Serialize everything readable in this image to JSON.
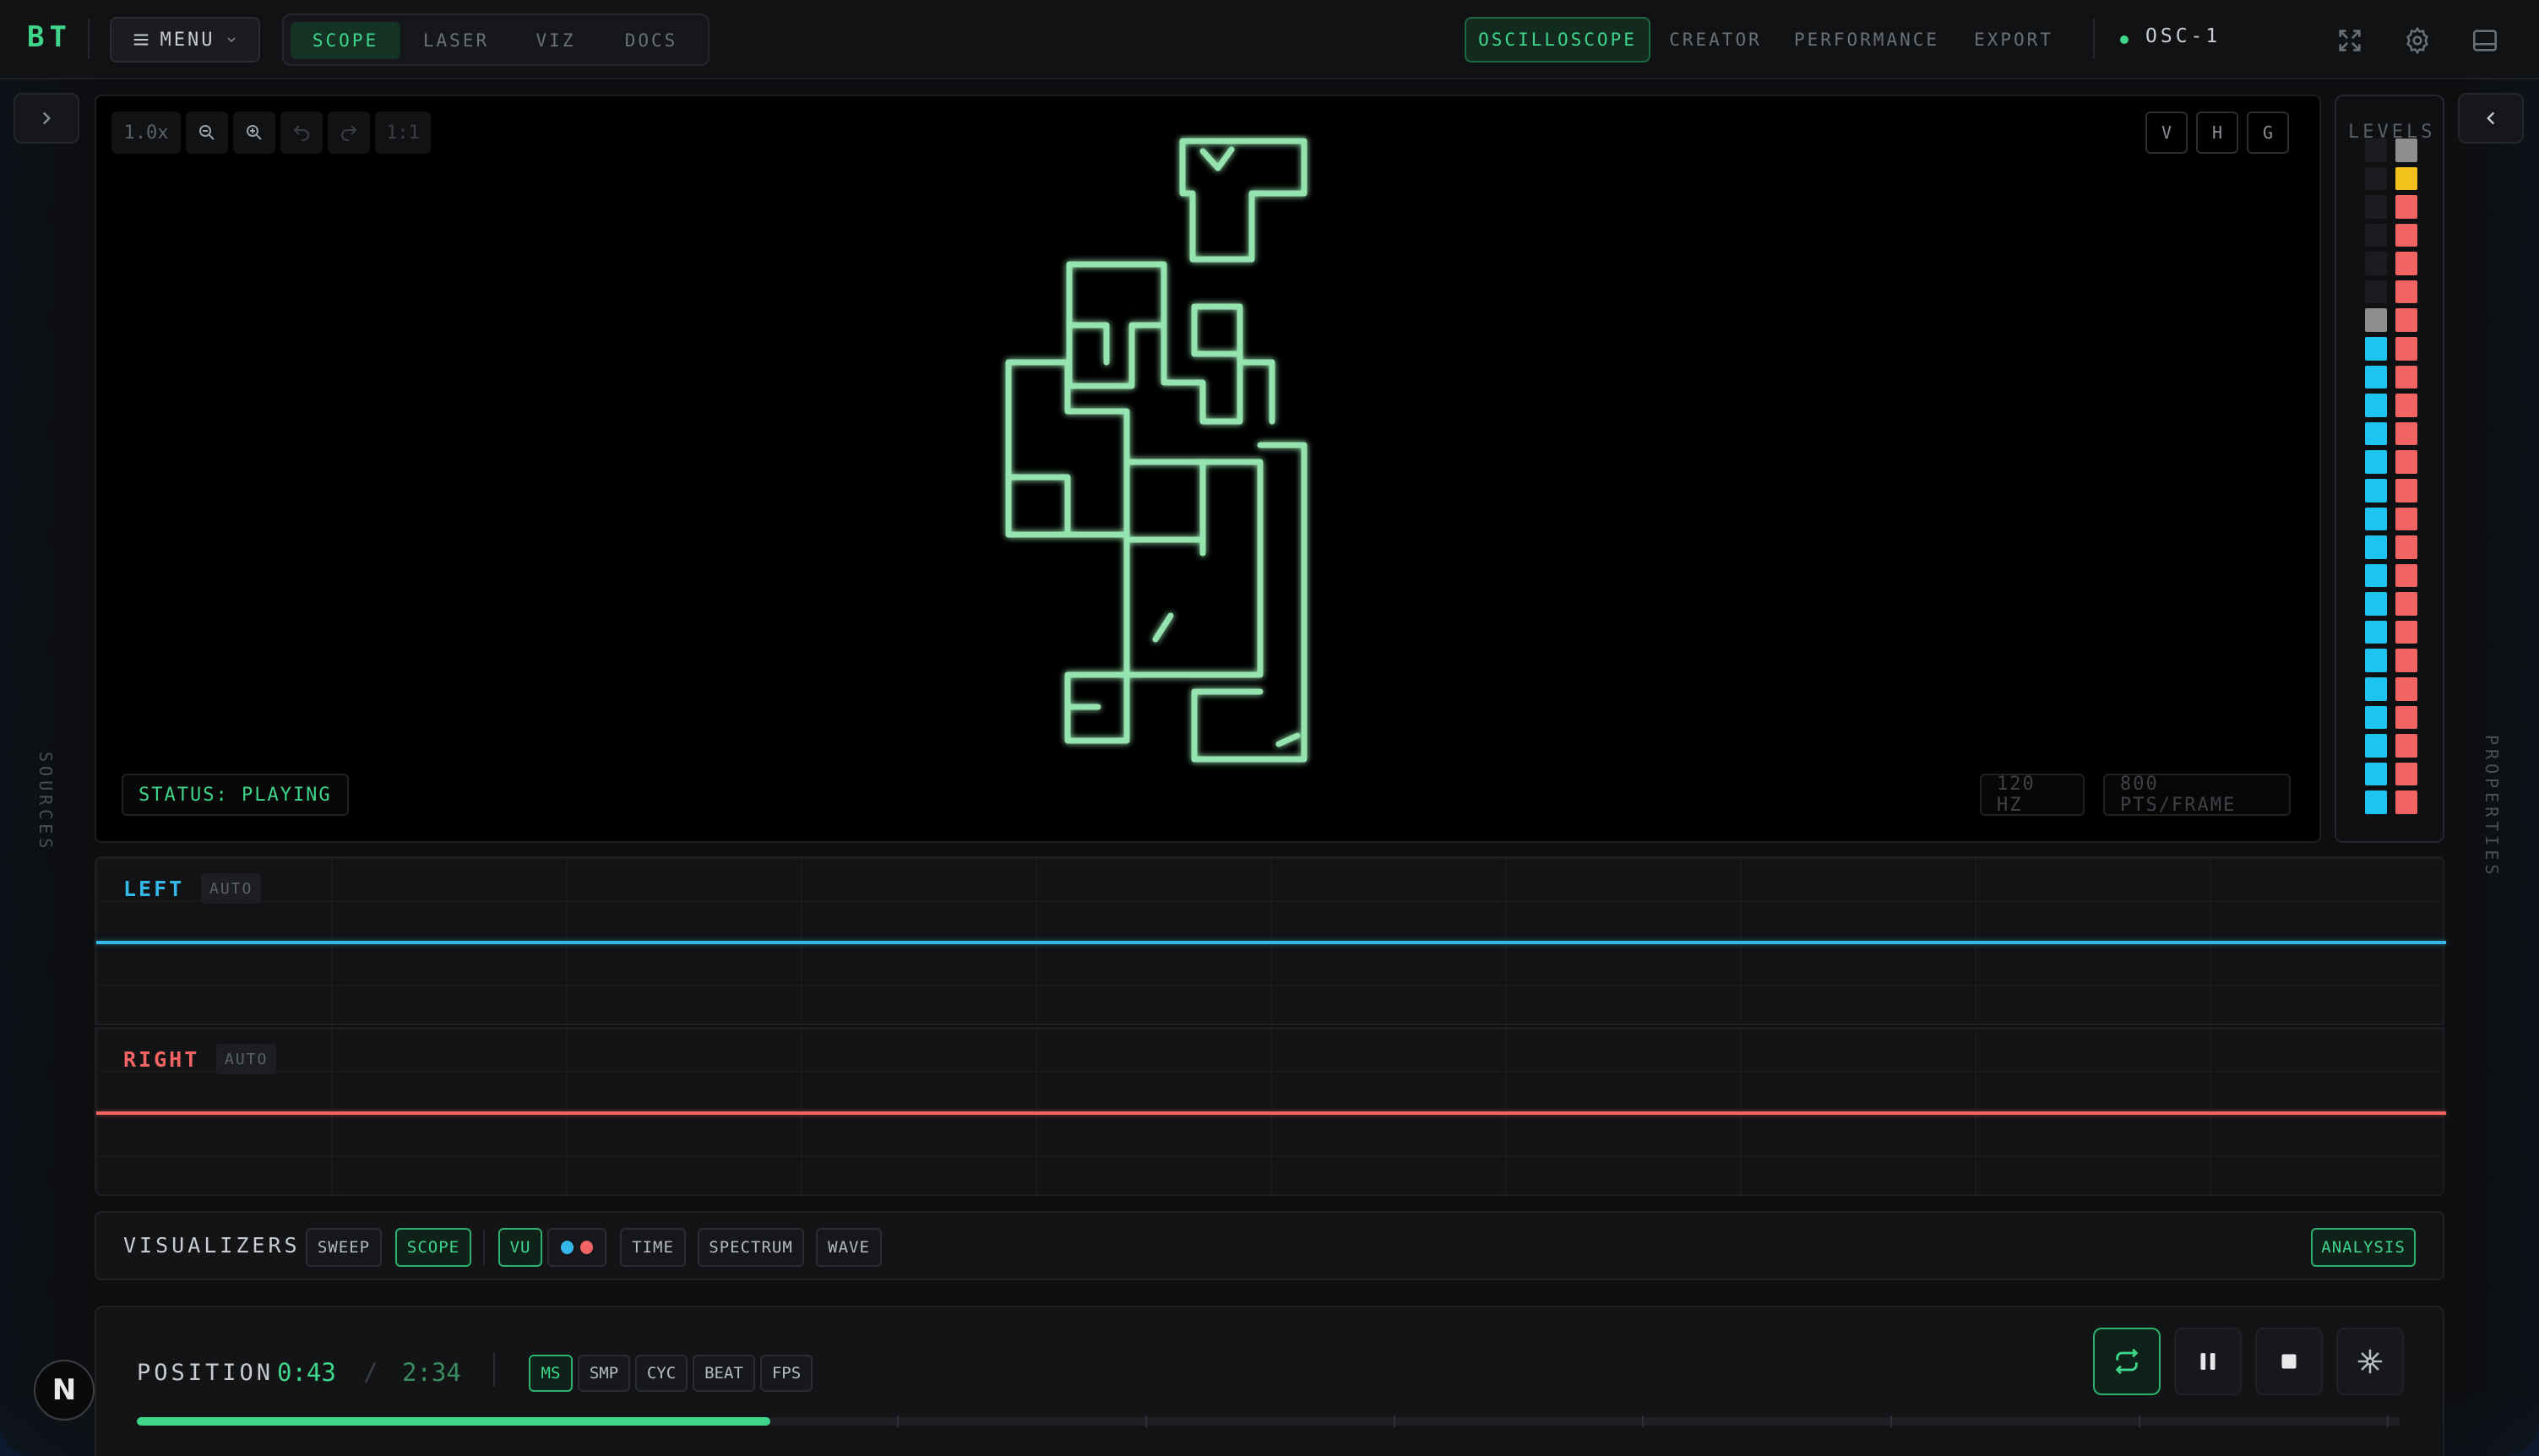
{
  "app": {
    "logo": "BT",
    "menu_label": "MENU"
  },
  "mode_tabs": [
    {
      "label": "SCOPE",
      "active": true
    },
    {
      "label": "LASER",
      "active": false
    },
    {
      "label": "VIZ",
      "active": false
    },
    {
      "label": "DOCS",
      "active": false
    }
  ],
  "nav_tabs": [
    {
      "label": "OSCILLOSCOPE",
      "active": true
    },
    {
      "label": "CREATOR",
      "active": false
    },
    {
      "label": "PERFORMANCE",
      "active": false
    },
    {
      "label": "EXPORT",
      "active": false
    }
  ],
  "device": {
    "name": "OSC-1",
    "status_color": "#3fd58a"
  },
  "top_icons": [
    "fullscreen-icon",
    "gear-icon",
    "panel-icon"
  ],
  "sidebars": {
    "left_label": "SOURCES",
    "right_label": "PROPERTIES"
  },
  "scope": {
    "zoom_level": "1.0x",
    "reset_zoom_label": "1:1",
    "axis_buttons": [
      "V",
      "H",
      "G"
    ],
    "status": "STATUS: PLAYING",
    "refresh_rate": "120 HZ",
    "points_per_frame": "800 PTS/FRAME",
    "trace_color": "#9ef0b8"
  },
  "levels": {
    "title": "LEVELS",
    "left_level": 0.73,
    "right_level": 0.95,
    "left_color": "#1fc3f0",
    "right_color": "#f26464"
  },
  "channels": {
    "left": {
      "name": "LEFT",
      "mode": "AUTO",
      "color": "#35b8e8"
    },
    "right": {
      "name": "RIGHT",
      "mode": "AUTO",
      "color": "#f26464"
    }
  },
  "visualizers": {
    "title": "VISUALIZERS",
    "buttons": [
      {
        "label": "SWEEP",
        "active": false
      },
      {
        "label": "SCOPE",
        "active": true
      },
      {
        "label": "VU",
        "active": true
      },
      {
        "label": "TIME",
        "active": false
      },
      {
        "label": "SPECTRUM",
        "active": false
      },
      {
        "label": "WAVE",
        "active": false
      }
    ],
    "analysis_label": "ANALYSIS"
  },
  "transport": {
    "position_label": "POSITION",
    "current": "0:43",
    "separator": "/",
    "total": "2:34",
    "progress": 0.28,
    "units": [
      {
        "label": "MS",
        "active": true
      },
      {
        "label": "SMP",
        "active": false
      },
      {
        "label": "CYC",
        "active": false
      },
      {
        "label": "BEAT",
        "active": false
      },
      {
        "label": "FPS",
        "active": false
      }
    ],
    "controls": [
      "loop-icon",
      "pause-icon",
      "stop-icon",
      "snowflake-icon"
    ]
  },
  "badge": {
    "letter": "N"
  }
}
